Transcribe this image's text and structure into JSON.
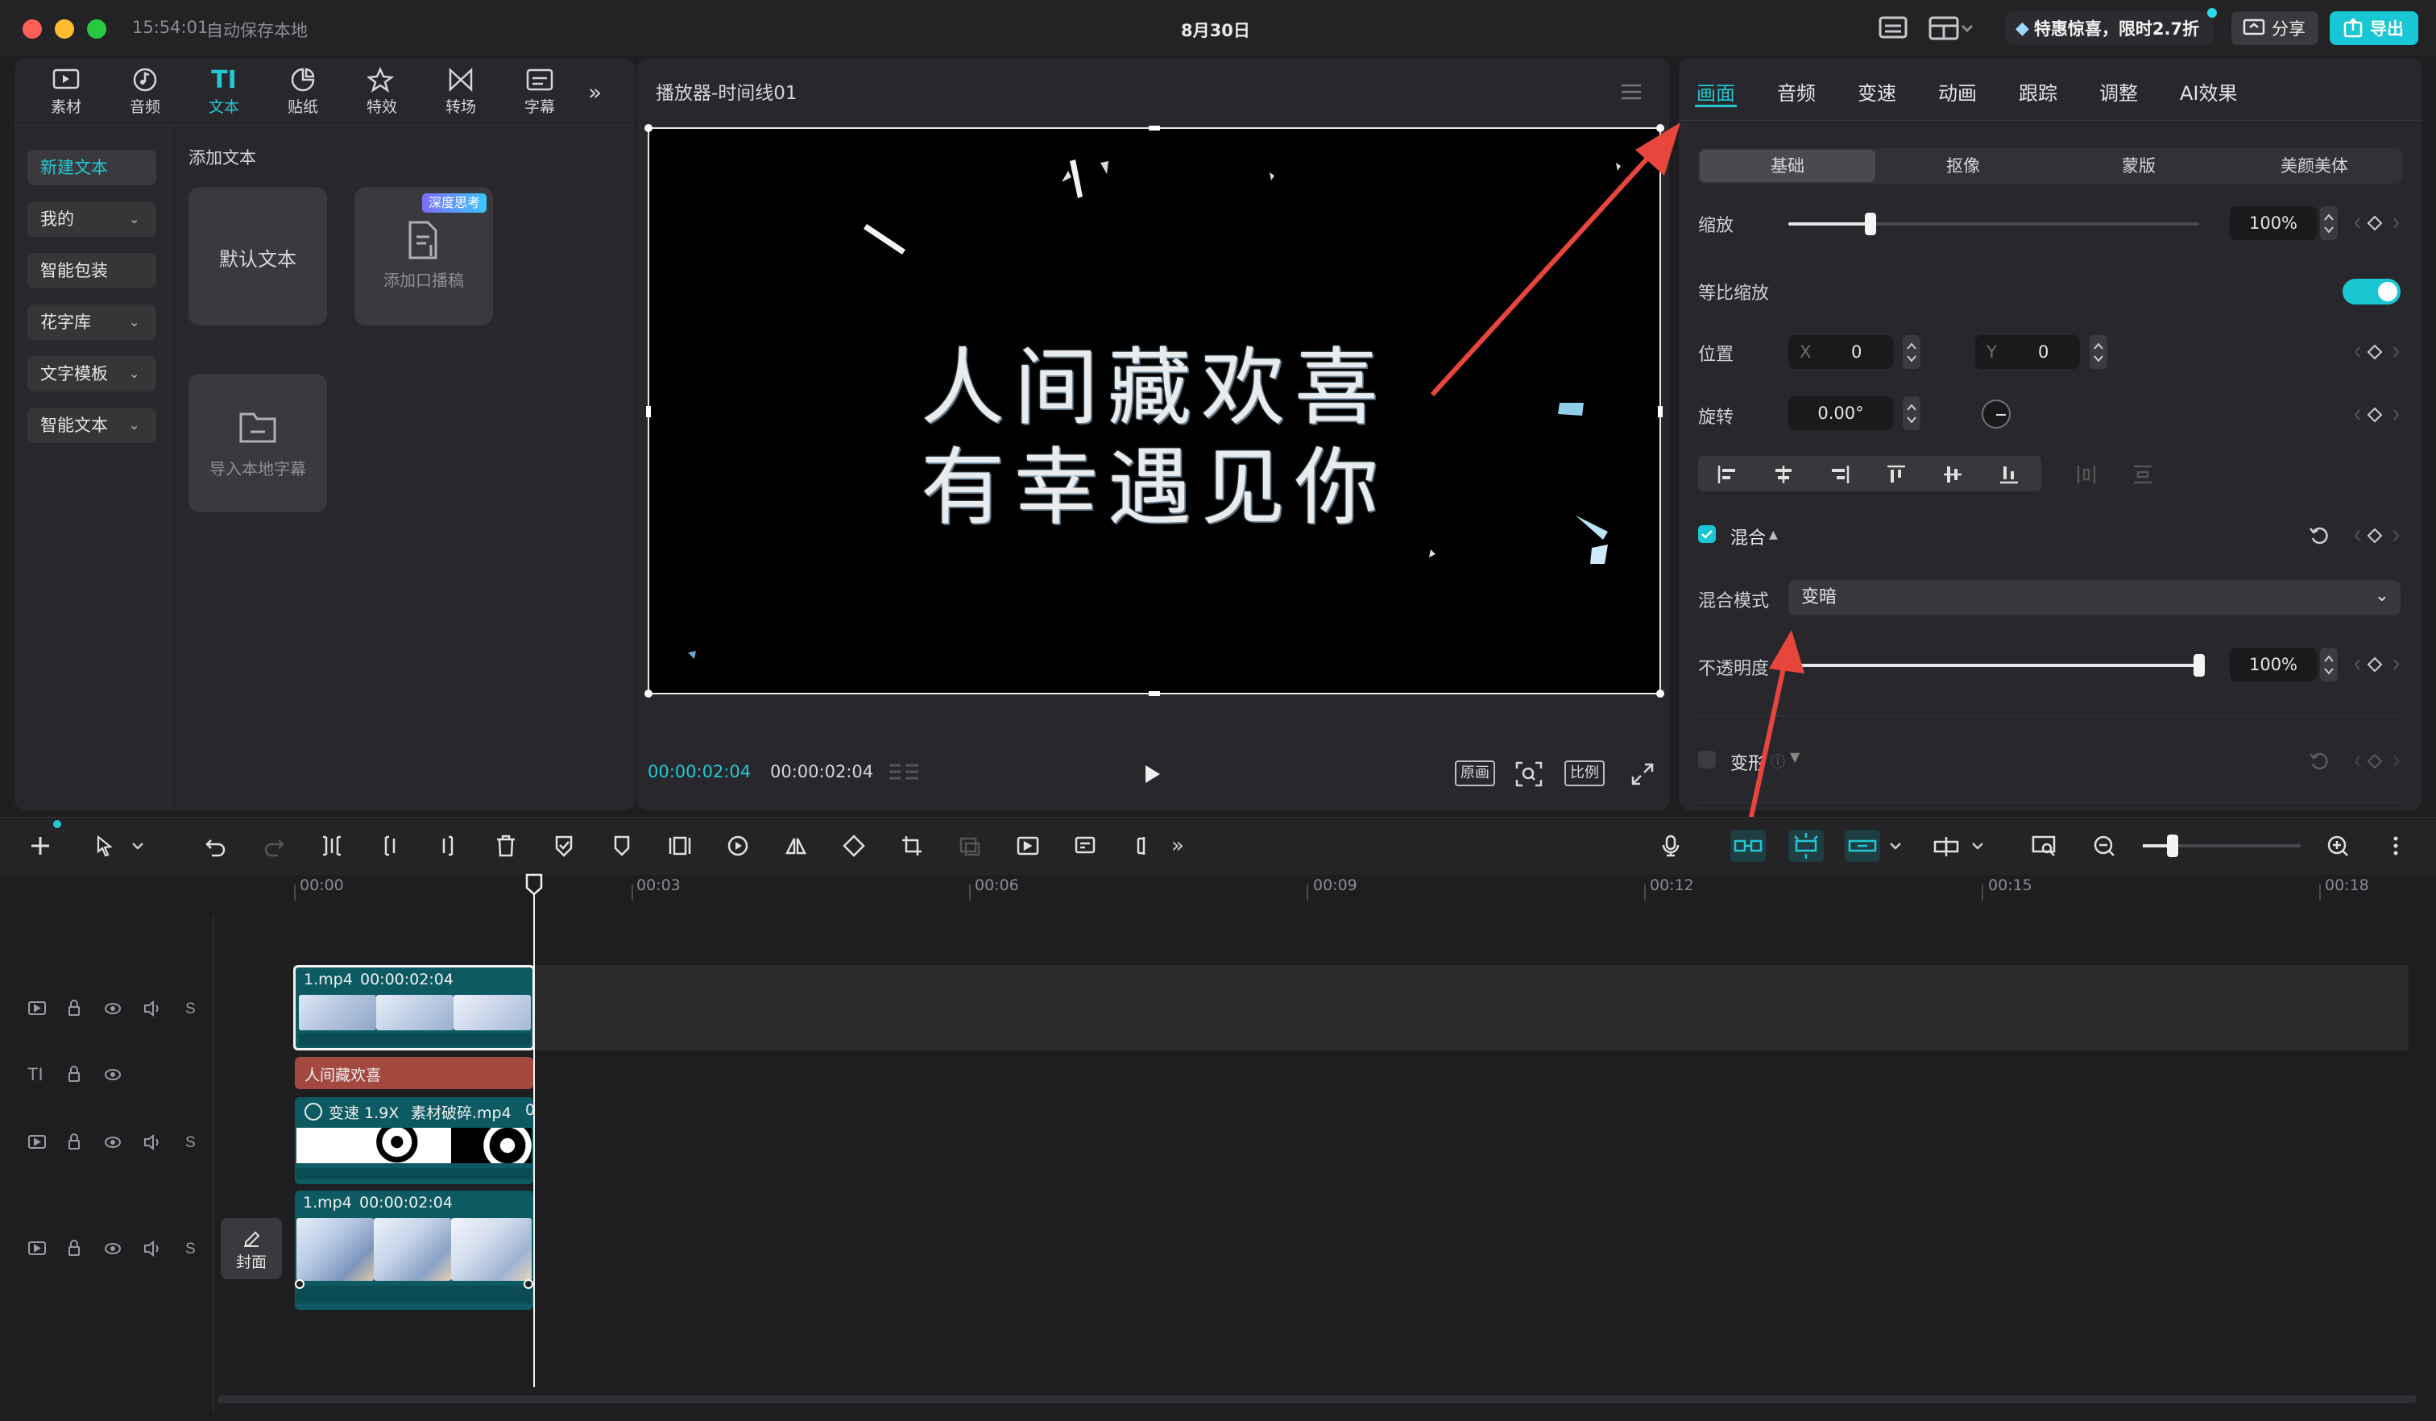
{
  "titlebar": {
    "time": "15:54:01",
    "autosave": "自动保存本地",
    "date": "8月30日",
    "promo": "特惠惊喜，限时2.7折",
    "share": "分享",
    "export": "导出"
  },
  "nav": {
    "tabs": [
      "素材",
      "音频",
      "文本",
      "贴纸",
      "特效",
      "转场",
      "字幕"
    ],
    "active": "文本"
  },
  "left": {
    "items": [
      "新建文本",
      "我的",
      "智能包装",
      "花字库",
      "文字模板",
      "智能文本"
    ],
    "section_title": "添加文本",
    "cards": {
      "default": "默认文本",
      "voice_badge": "深度思考",
      "voice": "添加口播稿",
      "import": "导入本地字幕"
    }
  },
  "player": {
    "title": "播放器-时间线01",
    "line1": "人间藏欢喜",
    "line2": "有幸遇见你",
    "current": "00:00:02:04",
    "total": "00:00:02:04",
    "btn_orig": "原画",
    "btn_ratio": "比例"
  },
  "props": {
    "tabs": [
      "画面",
      "音频",
      "变速",
      "动画",
      "跟踪",
      "调整",
      "AI效果"
    ],
    "active_tab": "画面",
    "subtabs": [
      "基础",
      "抠像",
      "蒙版",
      "美颜美体"
    ],
    "scale_label": "缩放",
    "scale_value": "100%",
    "scale_level": 0.2,
    "uniform_label": "等比缩放",
    "pos_label": "位置",
    "pos_x_label": "X",
    "pos_x": "0",
    "pos_y_label": "Y",
    "pos_y": "0",
    "rot_label": "旋转",
    "rot_value": "0.00°",
    "blend_label": "混合",
    "blend_mode_label": "混合模式",
    "blend_mode": "变暗",
    "opacity_label": "不透明度",
    "opacity_value": "100%",
    "opacity_level": 1.0,
    "transform_label": "变形"
  },
  "timeline": {
    "ticks": [
      "00:00",
      "00:03",
      "00:06",
      "00:09",
      "00:12",
      "00:15",
      "00:18"
    ],
    "cover": "封面",
    "clip1_name": "1.mp4",
    "clip1_dur": "00:00:02:04",
    "text_clip": "人间藏欢喜",
    "fx_speed": "变速 1.9X",
    "fx_name": "素材破碎.mp4",
    "fx_tail": "0",
    "clip2_name": "1.mp4",
    "clip2_dur": "00:00:02:04",
    "s_label": "S"
  },
  "colors": {
    "accent": "#1ad0d8",
    "text_clip": "#a3493f",
    "video_clip": "#0e5a63",
    "arrow": "#e8453c"
  }
}
